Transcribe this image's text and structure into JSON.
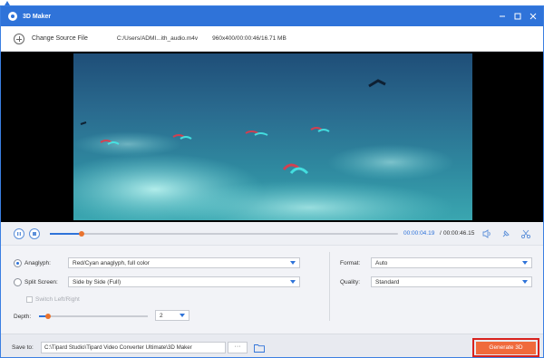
{
  "window": {
    "title": "3D Maker"
  },
  "topbar": {
    "add_label": "Change Source File",
    "file_path": "C:/Users/ADMI...ith_audio.m4v",
    "file_info": "960x400/00:00:46/16.71 MB"
  },
  "playback": {
    "current_time": "00:00:04.19",
    "separator": "/",
    "total_time": "00:00:46.15",
    "progress_fraction": 0.09
  },
  "settings": {
    "anaglyph_label": "Anaglyph:",
    "anaglyph_value": "Red/Cyan anaglyph, full color",
    "anaglyph_selected": true,
    "split_label": "Split Screen:",
    "split_value": "Side by Side (Full)",
    "switch_label": "Switch Left/Right",
    "depth_label": "Depth:",
    "depth_value": "2",
    "depth_fraction": 0.08,
    "format_label": "Format:",
    "format_value": "Auto",
    "quality_label": "Quality:",
    "quality_value": "Standard"
  },
  "bottom": {
    "save_label": "Save to:",
    "save_path": "C:\\Tipard Studio\\Tipard Video Converter Ultimate\\3D Maker",
    "browse_label": "···",
    "generate_label": "Generate 3D"
  },
  "colors": {
    "accent": "#2f73d9",
    "generate": "#f06a3c",
    "highlight": "#d8221e",
    "knob": "#e9732f"
  }
}
